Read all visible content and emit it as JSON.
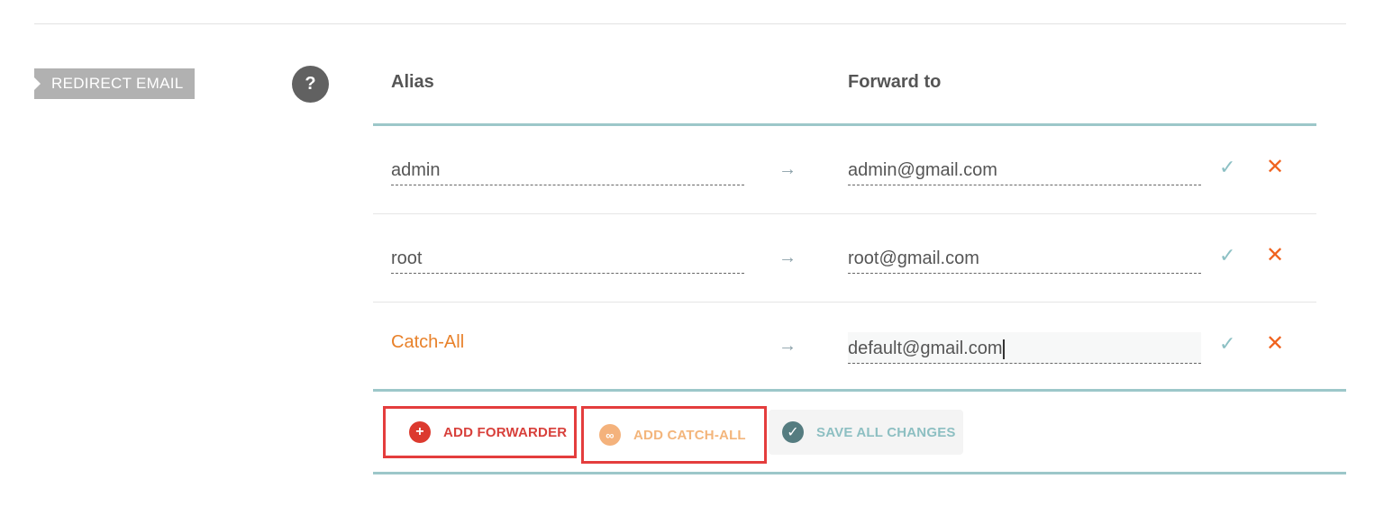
{
  "section": {
    "tag_label": "REDIRECT EMAIL",
    "help_glyph": "?"
  },
  "table": {
    "alias_header": "Alias",
    "forward_header": "Forward to",
    "arrow_glyph": "→",
    "confirm_glyph": "✓",
    "remove_glyph": "✕",
    "rows": [
      {
        "alias": "admin",
        "forward_to": "admin@gmail.com"
      },
      {
        "alias": "root",
        "forward_to": "root@gmail.com"
      },
      {
        "alias": "Catch-All",
        "forward_to": "default@gmail.com"
      }
    ]
  },
  "actions": {
    "add_forwarder": "ADD FORWARDER",
    "add_catch_all": "ADD CATCH-ALL",
    "save_all": "SAVE ALL CHANGES"
  },
  "icons": {
    "add_forwarder": "plus-circle-icon",
    "add_catch_all": "infinity-circle-icon",
    "save_all": "check-circle-icon",
    "help": "question-circle-icon"
  },
  "colors": {
    "accent_teal": "#9cc7c9",
    "catch_all_orange": "#e8812a",
    "remove_orange": "#f0631f",
    "highlight_red": "#e43d3d"
  }
}
